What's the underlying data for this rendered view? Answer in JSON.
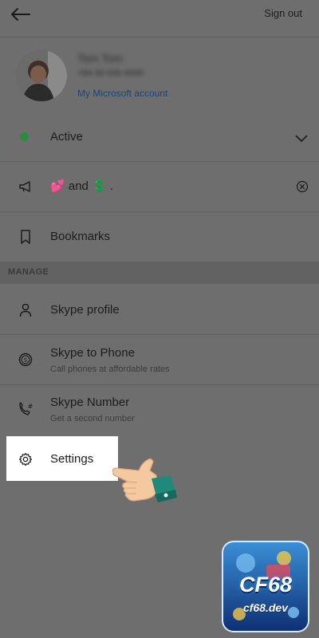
{
  "header": {
    "back_icon": "back-arrow-icon",
    "signout_label": "Sign out"
  },
  "profile": {
    "name": "Tom Tom",
    "phone": "+84 90 000 0000",
    "account_link": "My Microsoft account"
  },
  "status": {
    "label": "Active",
    "dot_color": "#2e8b3c",
    "chevron_icon": "chevron-down-icon"
  },
  "mood": {
    "icon": "megaphone-icon",
    "text": "and",
    "period": ".",
    "heart_emoji": "💕",
    "dollar_emoji": "💲",
    "clear_icon": "clear-circle-icon"
  },
  "bookmarks": {
    "icon": "bookmark-icon",
    "label": "Bookmarks"
  },
  "manage": {
    "section_label": "MANAGE",
    "items": [
      {
        "icon": "person-icon",
        "label": "Skype profile",
        "sublabel": ""
      },
      {
        "icon": "skype-credit-icon",
        "label": "Skype to Phone",
        "sublabel": "Call phones at affordable rates"
      },
      {
        "icon": "phone-number-icon",
        "label": "Skype Number",
        "sublabel": "Get a second number"
      },
      {
        "icon": "gear-icon",
        "label": "Settings",
        "sublabel": ""
      }
    ]
  },
  "overlay": {
    "hand_icon": "pointing-hand-icon",
    "badge": {
      "logo_text": "CF68",
      "domain_text": "cf68.dev"
    }
  }
}
